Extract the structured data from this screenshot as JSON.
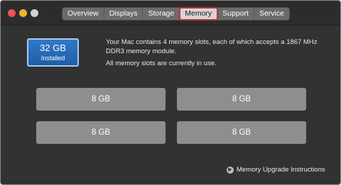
{
  "window": {
    "colors": {
      "close": "#f25056",
      "minimize": "#f4b12d",
      "maximize": "#d1d1d3",
      "accent_selected_outline": "#c62f33",
      "installed_badge": "#2468b4"
    }
  },
  "tabs": [
    {
      "label": "Overview"
    },
    {
      "label": "Displays"
    },
    {
      "label": "Storage"
    },
    {
      "label": "Memory",
      "selected": true
    },
    {
      "label": "Support"
    },
    {
      "label": "Service"
    }
  ],
  "memory": {
    "installed_amount": "32 GB",
    "installed_label": "Installed",
    "description_1": "Your Mac contains 4 memory slots, each of which accepts a 1867 MHz DDR3 memory module.",
    "description_2": "All memory slots are currently in use.",
    "slots": [
      "8 GB",
      "8 GB",
      "8 GB",
      "8 GB"
    ],
    "upgrade_link": "Memory Upgrade Instructions",
    "upgrade_icon": "arrow-circle-icon"
  }
}
